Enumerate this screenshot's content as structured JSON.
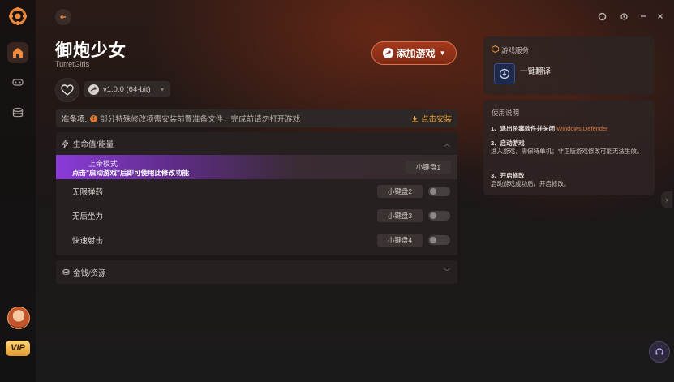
{
  "app": {
    "vip_label": "VIP"
  },
  "game": {
    "title": "御炮少女",
    "subtitle": "TurretGirls",
    "version": "v1.0.0 (64-bit)",
    "add_game_label": "添加游戏"
  },
  "prereq": {
    "label": "准备项:",
    "message": "部分特殊修改项需安装前置准备文件，完成前请勿打开游戏",
    "install_label": "点击安装"
  },
  "sections": {
    "health": {
      "title": "生命值/能量",
      "rows": [
        {
          "name": "上帝模式",
          "hint": "点击\"启动游戏\"后即可使用此修改功能",
          "hotkey": "小键盘1"
        },
        {
          "name": "无限弹药",
          "hotkey": "小键盘2"
        },
        {
          "name": "无后坐力",
          "hotkey": "小键盘3"
        },
        {
          "name": "快速射击",
          "hotkey": "小键盘4"
        }
      ]
    },
    "money": {
      "title": "金钱/资源"
    }
  },
  "right": {
    "service_title": "游戏服务",
    "translate_label": "一键翻译",
    "instructions_title": "使用说明",
    "steps": [
      {
        "heading": "1、退出杀毒软件并关闭",
        "accent": "Windows Defender"
      },
      {
        "heading": "2、启动游戏",
        "body": "进入游戏，需保持单机；非正版游戏修改可能无法生效。"
      },
      {
        "heading": "3、开启修改",
        "body": "启动游戏成功后，开启修改。"
      }
    ]
  },
  "colors": {
    "accent": "#e07a3a",
    "vip": "#f0b24a",
    "highlight": "#8a3bd9"
  }
}
